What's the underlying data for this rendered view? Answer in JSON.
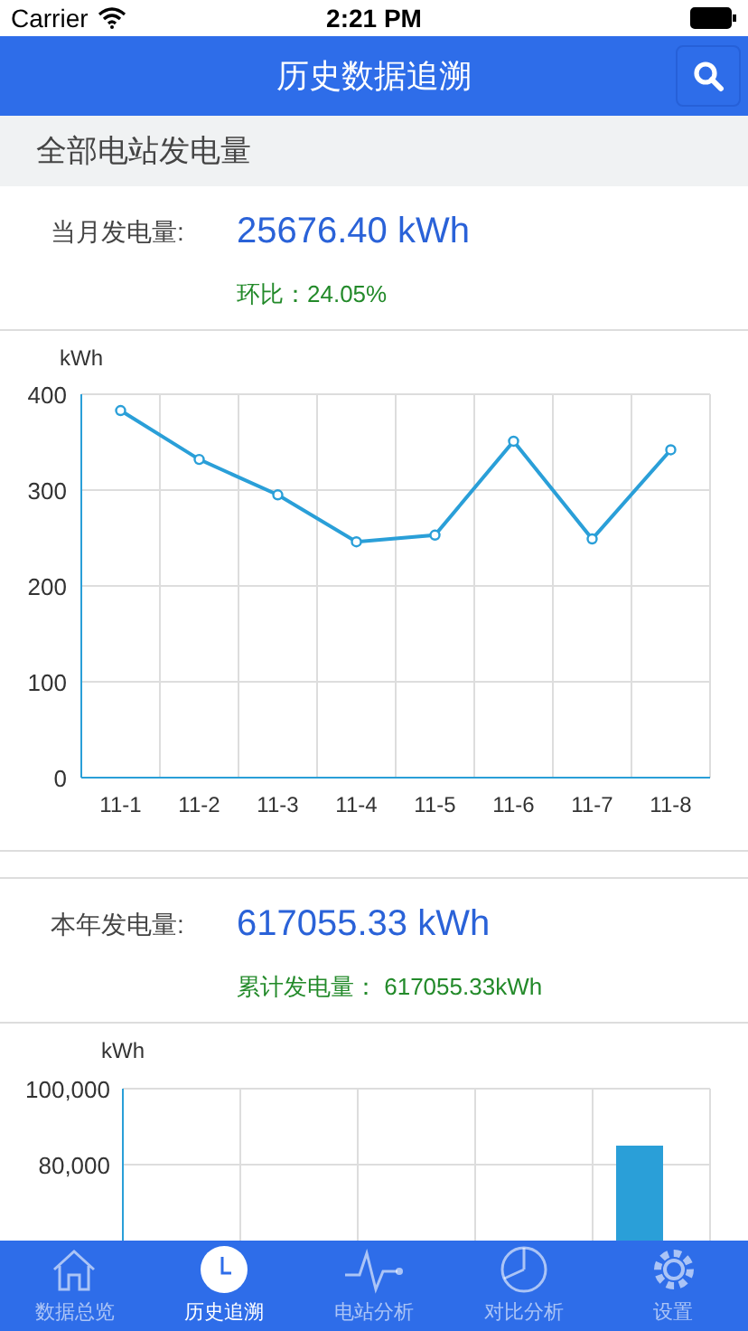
{
  "status_bar": {
    "carrier": "Carrier",
    "time": "2:21 PM"
  },
  "nav": {
    "title": "历史数据追溯"
  },
  "section": {
    "title": "全部电站发电量"
  },
  "month": {
    "label": "当月发电量:",
    "value": "25676.40 kWh",
    "sub": "环比：24.05%"
  },
  "month_chart": {
    "chart_data": {
      "type": "line",
      "ylabel": "kWh",
      "categories": [
        "11-1",
        "11-2",
        "11-3",
        "11-4",
        "11-5",
        "11-6",
        "11-7",
        "11-8"
      ],
      "values": [
        383,
        332,
        295,
        246,
        253,
        351,
        249,
        342
      ],
      "grid": true,
      "marker": true,
      "ylim": [
        0,
        400
      ],
      "yticks": [
        0,
        100,
        200,
        300,
        400
      ]
    }
  },
  "year": {
    "label": "本年发电量:",
    "value": "617055.33 kWh",
    "sub": "累计发电量：  617055.33kWh"
  },
  "year_chart": {
    "chart_data": {
      "type": "bar",
      "ylabel": "kWh",
      "values": [
        null,
        null,
        null,
        null,
        85000
      ],
      "grid": true,
      "ylim": [
        60000,
        100000
      ],
      "yticks": [
        {
          "value": 80000,
          "label": "80,000"
        },
        {
          "value": 100000,
          "label": "100,000"
        }
      ]
    }
  },
  "tabs": [
    {
      "label": "数据总览",
      "kind": "home",
      "selected": false
    },
    {
      "label": "历史追溯",
      "kind": "clock",
      "selected": true
    },
    {
      "label": "电站分析",
      "kind": "pulse",
      "selected": false
    },
    {
      "label": "对比分析",
      "kind": "pie",
      "selected": false
    },
    {
      "label": "设置",
      "kind": "gear",
      "selected": false
    }
  ]
}
